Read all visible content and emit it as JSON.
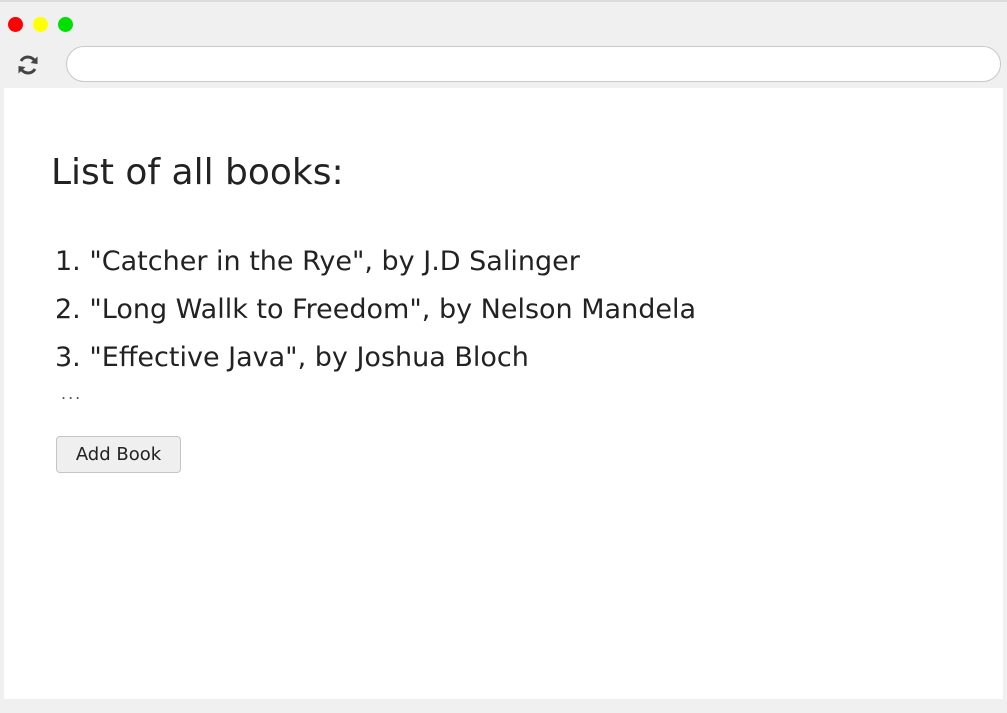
{
  "browser": {
    "address_value": ""
  },
  "page": {
    "title": "List of all books:",
    "books": [
      "1. \"Catcher in the Rye\", by J.D Salinger",
      "2. \"Long Wallk to Freedom\", by Nelson Mandela",
      "3. \"Effective Java\", by Joshua Bloch"
    ],
    "ellipsis": "...",
    "add_button_label": "Add Book"
  },
  "icons": {
    "reload": "reload-icon"
  },
  "colors": {
    "close_dot": "#ff0000",
    "minimize_dot": "#ffff00",
    "maximize_dot": "#00e000"
  }
}
